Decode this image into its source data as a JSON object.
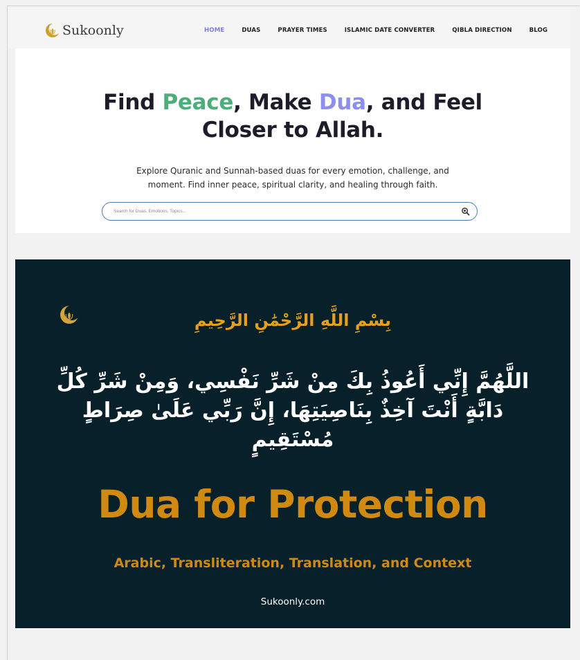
{
  "brand": {
    "name": "Sukoonly",
    "accent": "#c9a227"
  },
  "nav": {
    "items": [
      {
        "label": "HOME",
        "active": true
      },
      {
        "label": "DUAS",
        "active": false
      },
      {
        "label": "PRAYER TIMES",
        "active": false
      },
      {
        "label": "ISLAMIC DATE CONVERTER",
        "active": false
      },
      {
        "label": "QIBLA DIRECTION",
        "active": false
      },
      {
        "label": "BLOG",
        "active": false
      }
    ]
  },
  "hero": {
    "title_part1": "Find ",
    "title_peace": "Peace",
    "title_part2": ", Make ",
    "title_dua": "Dua",
    "title_part3": ", and Feel",
    "title_line2": "Closer to Allah.",
    "subtitle_line1": "Explore Quranic and Sunnah-based duas for every emotion, challenge, and",
    "subtitle_line2": "moment. Find inner peace, spiritual clarity, and healing through faith.",
    "search_placeholder": "Search for Duas, Emotions, Topics...",
    "colors": {
      "peace": "#4caf7a",
      "dua": "#8d8ff0"
    }
  },
  "banner": {
    "bismillah": "بِسْمِ اللَّهِ الرَّحْمَٰنِ الرَّحِيمِ",
    "arabic_line1": "اللَّهُمَّ إِنِّي أَعُوذُ بِكَ مِنْ شَرِّ نَفْسِي، وَمِنْ شَرِّ كُلِّ",
    "arabic_line2": "دَابَّةٍ أَنْتَ آخِذٌ بِنَاصِيَتِهَا، إِنَّ رَبِّي عَلَىٰ صِرَاطٍ",
    "arabic_line3": "مُسْتَقِيمٍ",
    "title": "Dua for Protection",
    "subtitle": "Arabic, Transliteration, Translation, and Context",
    "site": "Sukoonly.com",
    "colors": {
      "background": "#072029",
      "gold": "#d08a12"
    }
  }
}
